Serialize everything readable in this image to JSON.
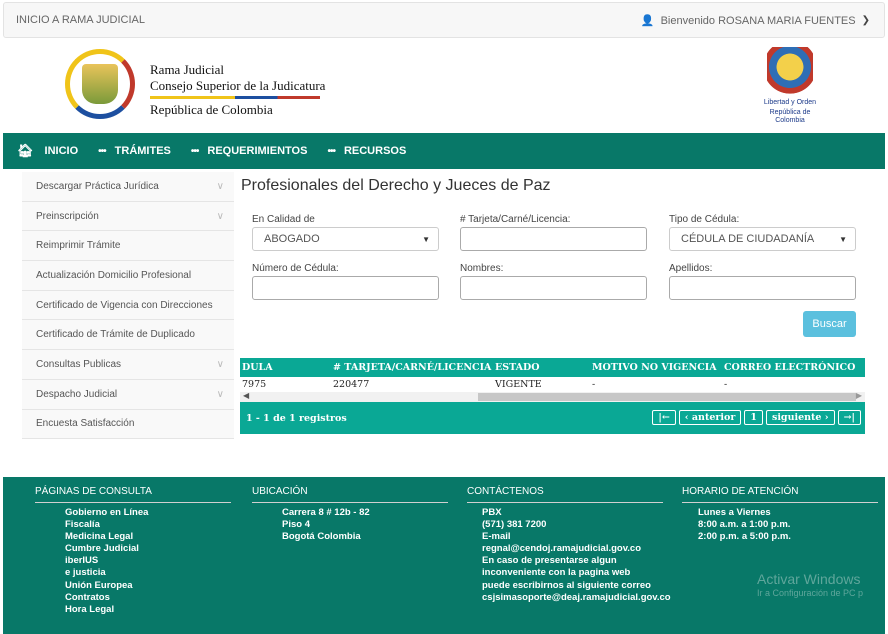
{
  "topbar": {
    "home_link": "INICIO A RAMA JUDICIAL",
    "welcome": "Bienvenido ROSANA MARIA FUENTES"
  },
  "header": {
    "org_line1": "Rama Judicial",
    "org_line2": "Consejo Superior de la Judicatura",
    "org_line3": "República de Colombia",
    "coat_caption1": "Libertad y Orden",
    "coat_caption2": "República de Colombia"
  },
  "nav": {
    "items": [
      "INICIO",
      "TRÁMITES",
      "REQUERIMIENTOS",
      "RECURSOS"
    ]
  },
  "sidebar": {
    "items": [
      {
        "label": "Descargar Práctica Jurídica",
        "chevron": true
      },
      {
        "label": "Preinscripción",
        "chevron": true
      },
      {
        "label": "Reimprimir Trámite",
        "chevron": false
      },
      {
        "label": "Actualización Domicilio Profesional",
        "chevron": false
      },
      {
        "label": "Certificado de Vigencia con Direcciones",
        "chevron": false
      },
      {
        "label": "Certificado de Trámite de Duplicado",
        "chevron": false
      },
      {
        "label": "Consultas Publicas",
        "chevron": true
      },
      {
        "label": "Despacho Judicial",
        "chevron": true
      },
      {
        "label": "Encuesta Satisfacción",
        "chevron": false
      }
    ]
  },
  "main": {
    "title": "Profesionales del Derecho y Jueces de Paz",
    "fields": {
      "calidad_label": "En Calidad de",
      "calidad_value": "ABOGADO",
      "tarjeta_label": "# Tarjeta/Carné/Licencia:",
      "tipo_label": "Tipo de Cédula:",
      "tipo_value": "CÉDULA DE CIUDADANÍA",
      "cedula_label": "Número de Cédula:",
      "nombres_label": "Nombres:",
      "apellidos_label": "Apellidos:"
    },
    "search_button": "Buscar"
  },
  "table": {
    "headers": [
      "DULA",
      "# TARJETA/CARNÉ/LICENCIA",
      "ESTADO",
      "MOTIVO NO VIGENCIA",
      "CORREO ELECTRÓNICO"
    ],
    "rows": [
      [
        "7975",
        "220477",
        "VIGENTE",
        "-",
        "-"
      ]
    ],
    "records": "1 - 1 de 1 registros",
    "pager": {
      "first": "|←",
      "prev": "‹ anterior",
      "page": "1",
      "next": "siguiente ›",
      "last": "→|"
    }
  },
  "footer": {
    "col1_title": "PÁGINAS DE CONSULTA",
    "col1_lines": [
      "Gobierno en Línea",
      "Fiscalía",
      "Medicina Legal",
      "Cumbre Judicial",
      "iberIUS",
      "e justicia",
      "Unión Europea",
      "Contratos",
      "Hora Legal"
    ],
    "col2_title": "UBICACIÓN",
    "col2_lines": [
      "Carrera 8 # 12b - 82",
      "Piso 4",
      "Bogotá Colombia"
    ],
    "col3_title": "CONTÁCTENOS",
    "col3_lines": [
      "PBX",
      "(571) 381 7200",
      "E-mail",
      "regnal@cendoj.ramajudicial.gov.co",
      "En caso de presentarse algun",
      "inconveniente con la pagina web",
      "puede escribirnos al siguiente correo",
      "csjsimasoporte@deaj.ramajudicial.gov.co"
    ],
    "col4_title": "HORARIO DE ATENCIÓN",
    "col4_lines": [
      "Lunes a Viernes",
      "8:00 a.m. a 1:00 p.m.",
      "2:00 p.m. a 5:00 p.m."
    ]
  },
  "watermark": {
    "line1": "Activar Windows",
    "line2": "Ir a Configuración de PC p"
  },
  "colors": {
    "brand_green": "#087868",
    "table_green": "#0aa895",
    "button_blue": "#5bc0de"
  }
}
